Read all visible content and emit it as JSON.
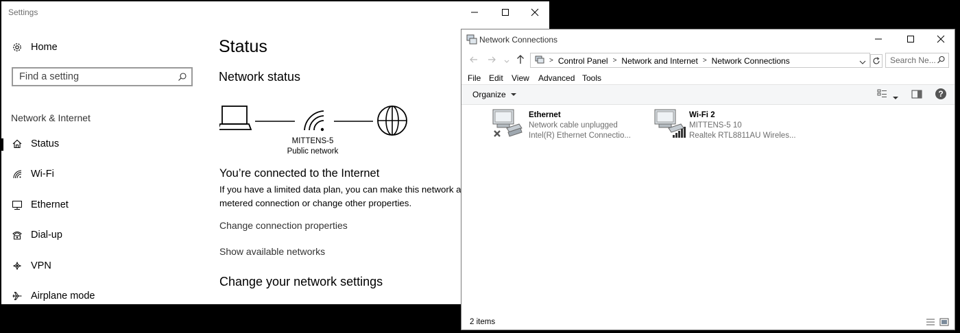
{
  "settings": {
    "window_title": "Settings",
    "home_label": "Home",
    "search_placeholder": "Find a setting",
    "section_label": "Network & Internet",
    "nav": [
      {
        "label": "Status",
        "icon": "home-status-icon"
      },
      {
        "label": "Wi-Fi",
        "icon": "wifi-icon"
      },
      {
        "label": "Ethernet",
        "icon": "ethernet-icon"
      },
      {
        "label": "Dial-up",
        "icon": "dialup-icon"
      },
      {
        "label": "VPN",
        "icon": "vpn-icon"
      },
      {
        "label": "Airplane mode",
        "icon": "airplane-icon"
      }
    ],
    "page_title": "Status",
    "network_status_heading": "Network status",
    "network_name": "MITTENS-5",
    "network_type": "Public network",
    "connected_heading": "You’re connected to the Internet",
    "connected_body_line1": "If you have a limited data plan, you can make this network a",
    "connected_body_line2": "metered connection or change other properties.",
    "change_props_link": "Change connection properties",
    "show_networks_link": "Show available networks",
    "change_settings_heading": "Change your network settings"
  },
  "netconn": {
    "window_title": "Network Connections",
    "breadcrumb": [
      "Control Panel",
      "Network and Internet",
      "Network Connections"
    ],
    "search_placeholder": "Search Ne...",
    "menus": [
      "File",
      "Edit",
      "View",
      "Advanced",
      "Tools"
    ],
    "organize_label": "Organize",
    "items": [
      {
        "name": "Ethernet",
        "status": "Network cable unplugged",
        "adapter": "Intel(R) Ethernet Connectio..."
      },
      {
        "name": "Wi-Fi 2",
        "status": "MITTENS-5  10",
        "adapter": "Realtek RTL8811AU Wireles..."
      }
    ],
    "status_bar": "2 items"
  },
  "colors": {
    "link_text": "#333333",
    "accent_blue": "#1a74d1"
  }
}
